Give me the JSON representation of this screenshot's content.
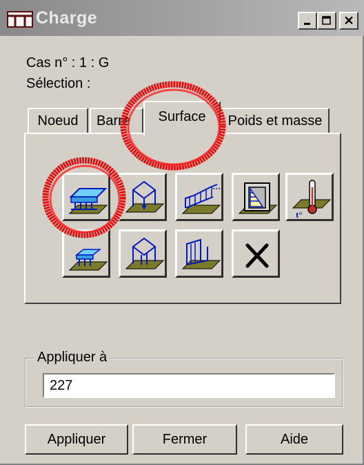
{
  "window": {
    "title": "Charge",
    "close_glyph": "✕"
  },
  "info": {
    "case_line": "Cas n° : 1 : G",
    "selection_line": "Sélection :"
  },
  "tabs": [
    {
      "label": "Noeud"
    },
    {
      "label": "Barre"
    },
    {
      "label": "Surface",
      "selected": true
    },
    {
      "label": "Poids et masse"
    }
  ],
  "icon_buttons": [
    {
      "name": "uniform-surface-load-icon"
    },
    {
      "name": "planar-point-load-icon"
    },
    {
      "name": "linear-load-3d-icon"
    },
    {
      "name": "hydrostatic-pressure-icon"
    },
    {
      "name": "thermal-load-icon"
    },
    {
      "name": "contour-load-icon"
    },
    {
      "name": "planar-load-3-points-icon"
    },
    {
      "name": "linear-edge-load-icon"
    },
    {
      "name": "delete-load-icon"
    }
  ],
  "apply_to": {
    "label": "Appliquer à",
    "value": "227"
  },
  "buttons": {
    "apply": "Appliquer",
    "close": "Fermer",
    "help": "Aide"
  },
  "colors": {
    "annotation": "#e01010",
    "face": "#d4d0c8",
    "slab": "#6fd0ff",
    "ground": "#7a7a28"
  }
}
